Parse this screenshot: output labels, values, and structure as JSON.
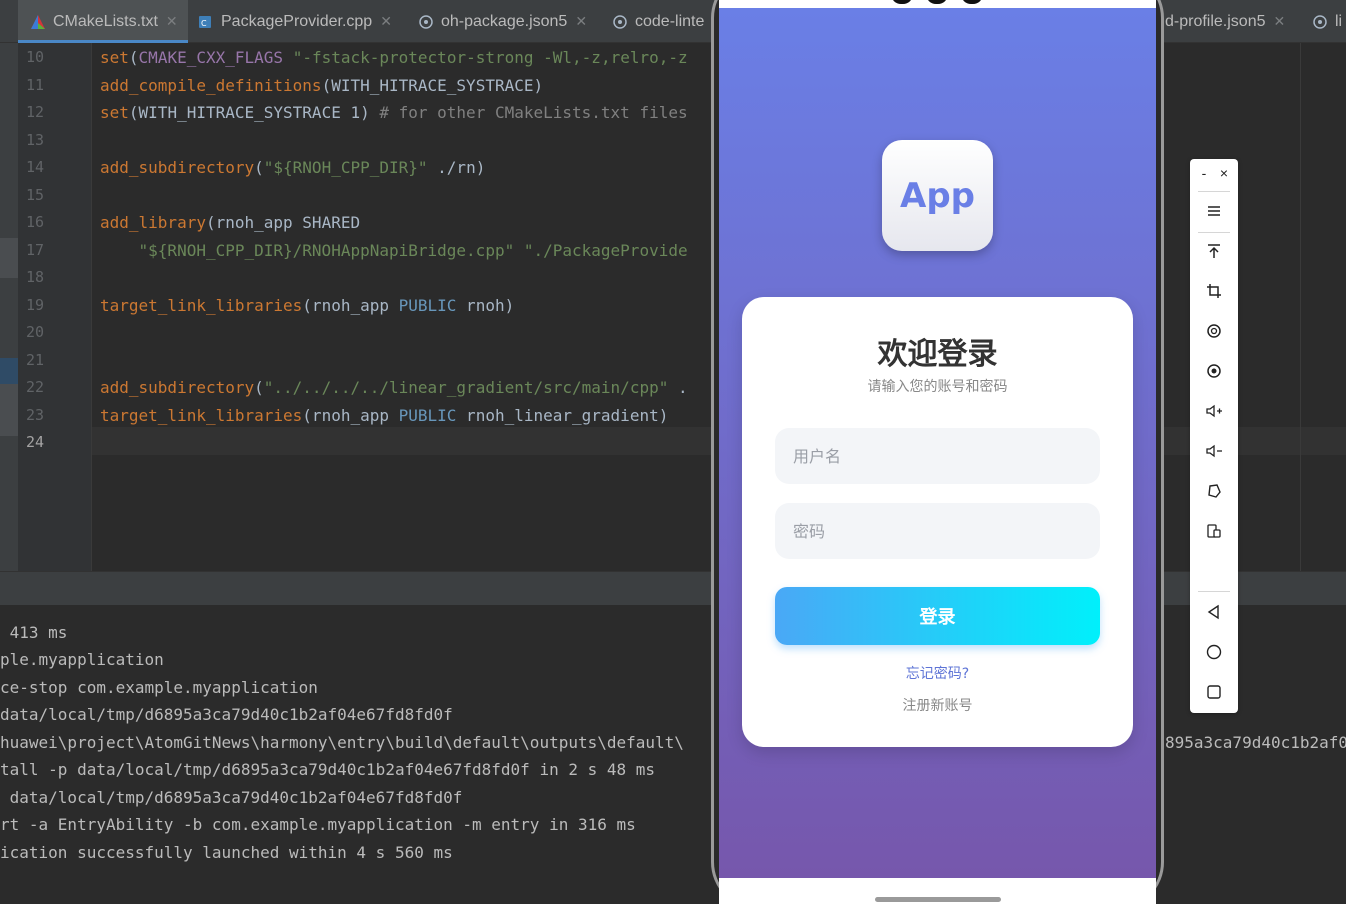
{
  "tabs": [
    {
      "label": "CMakeLists.txt",
      "active": true
    },
    {
      "label": "PackageProvider.cpp"
    },
    {
      "label": "oh-package.json5"
    },
    {
      "label": "code-linte"
    },
    {
      "label": "d-profile.json5"
    },
    {
      "label": "li"
    }
  ],
  "editor": {
    "line_numbers": [
      "10",
      "11",
      "12",
      "13",
      "14",
      "15",
      "16",
      "17",
      "18",
      "19",
      "20",
      "21",
      "22",
      "23",
      "24"
    ],
    "code": {
      "l10": {
        "fn": "set",
        "open": "(",
        "var": "CMAKE_CXX_FLAGS",
        "sp": " ",
        "str": "\"-fstack-protector-strong -Wl,-z,relro,-z"
      },
      "l11": {
        "fn": "add_compile_definitions",
        "rest": "(WITH_HITRACE_SYSTRACE)"
      },
      "l12": {
        "fn": "set",
        "rest": "(WITH_HITRACE_SYSTRACE 1) ",
        "com": "# for other CMakeLists.txt files"
      },
      "l14": {
        "fn": "add_subdirectory",
        "open": "(",
        "str": "\"${RNOH_CPP_DIR}\"",
        "rest": " ./rn)"
      },
      "l16": {
        "fn": "add_library",
        "rest": "(rnoh_app SHARED"
      },
      "l17": {
        "indent": "    ",
        "str": "\"${RNOH_CPP_DIR}/RNOHAppNapiBridge.cpp\" \"./PackageProvide"
      },
      "l19": {
        "fn": "target_link_libraries",
        "rest": "(rnoh_app ",
        "kw": "PUBLIC",
        "rest2": " rnoh)"
      },
      "l22": {
        "fn": "add_subdirectory",
        "open": "(",
        "str": "\"../../../../linear_gradient/src/main/cpp\"",
        "rest": " ."
      },
      "l23": {
        "fn": "target_link_libraries",
        "rest": "(rnoh_app ",
        "kw": "PUBLIC",
        "rest2": " rnoh_linear_gradient)"
      }
    }
  },
  "console": {
    "lines": [
      " 413 ms",
      "ple.myapplication",
      "ce-stop com.example.myapplication",
      "data/local/tmp/d6895a3ca79d40c1b2af04e67fd8fd0f",
      "huawei\\project\\AtomGitNews\\harmony\\entry\\build\\default\\outputs\\default\\",
      "tall -p data/local/tmp/d6895a3ca79d40c1b2af04e67fd8fd0f in 2 s 48 ms",
      " data/local/tmp/d6895a3ca79d40c1b2af04e67fd8fd0f",
      "rt -a EntryAbility -b com.example.myapplication -m entry in 316 ms",
      "ication successfully launched within 4 s 560 ms"
    ],
    "right_fragment": "895a3ca79d40c1b2af0"
  },
  "phone": {
    "app_icon_text": "App",
    "title": "欢迎登录",
    "subtitle": "请输入您的账号和密码",
    "username_placeholder": "用户名",
    "password_placeholder": "密码",
    "login_label": "登录",
    "forgot_label": "忘记密码?",
    "register_label": "注册新账号"
  },
  "colors": {
    "gradient_top": "#6a7fe6",
    "gradient_bottom": "#7657ac",
    "button_start": "#4aa8f6",
    "button_end": "#00f0fb"
  },
  "toolbar": {
    "minimize": "-",
    "close": "×",
    "icons": [
      "menu-icon",
      "pin-top-icon",
      "crop-icon",
      "rotate-icon",
      "screenshot-icon",
      "volume-up-icon",
      "volume-down-icon",
      "shake-icon",
      "multi-device-icon",
      "back-icon",
      "home-icon",
      "recent-apps-icon"
    ]
  }
}
